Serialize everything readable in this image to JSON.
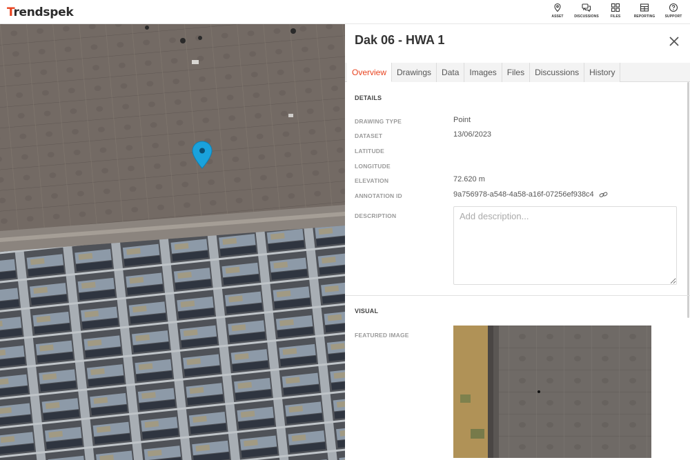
{
  "header": {
    "logo_text": "Trendspek",
    "nav": [
      {
        "label": "ASSET",
        "icon": "location-pin-icon"
      },
      {
        "label": "DISCUSSIONS",
        "icon": "chat-bubbles-icon"
      },
      {
        "label": "FILES",
        "icon": "files-icon"
      },
      {
        "label": "REPORTING",
        "icon": "report-table-icon"
      },
      {
        "label": "SUPPORT",
        "icon": "help-circle-icon"
      }
    ]
  },
  "map": {
    "marker_color": "#1aa2dc"
  },
  "panel": {
    "title": "Dak 06 - HWA 1",
    "tabs": [
      "Overview",
      "Drawings",
      "Data",
      "Images",
      "Files",
      "Discussions",
      "History"
    ],
    "active_tab": "Overview",
    "accent_color": "#e8431f",
    "details": {
      "section_title": "DETAILS",
      "fields": [
        {
          "label": "DRAWING TYPE",
          "value": "Point"
        },
        {
          "label": "DATASET",
          "value": "13/06/2023"
        },
        {
          "label": "LATITUDE",
          "value": ""
        },
        {
          "label": "LONGITUDE",
          "value": ""
        },
        {
          "label": "ELEVATION",
          "value": "72.620 m"
        },
        {
          "label": "ANNOTATION ID",
          "value": "9a756978-a548-4a58-a16f-07256ef938c4"
        }
      ],
      "description_label": "DESCRIPTION",
      "description_placeholder": "Add description...",
      "description_value": ""
    },
    "visual": {
      "section_title": "VISUAL",
      "featured_image_label": "FEATURED IMAGE"
    }
  }
}
